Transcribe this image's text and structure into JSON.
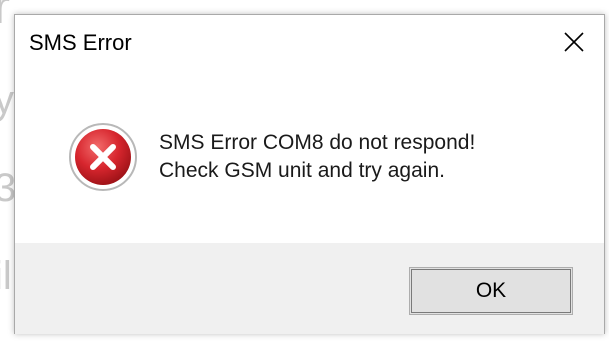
{
  "dialog": {
    "title": "SMS Error",
    "message_line1": "SMS Error COM8 do not respond!",
    "message_line2": "Check GSM unit and try again.",
    "ok_label": "OK",
    "icon": "error-icon",
    "close_icon": "close-icon"
  },
  "colors": {
    "error_red": "#d7262e",
    "footer_bg": "#f0f0f0",
    "button_bg": "#e1e1e1"
  }
}
